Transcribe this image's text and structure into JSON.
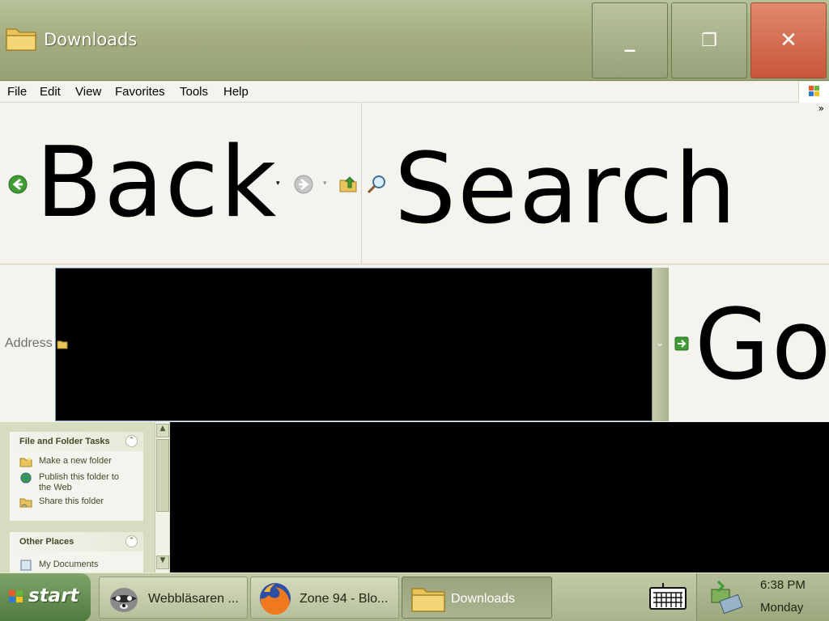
{
  "window": {
    "title": "Downloads",
    "min_glyph": "_",
    "max_glyph": "❐",
    "close_glyph": "✕"
  },
  "menu": {
    "file": "File",
    "edit": "Edit",
    "view": "View",
    "favorites": "Favorites",
    "tools": "Tools",
    "help": "Help"
  },
  "toolbar": {
    "back_label": "Back",
    "search_label": "Search",
    "more_glyph": "»"
  },
  "address": {
    "label": "Address",
    "go_label": "Go"
  },
  "left_panel": {
    "file_tasks": {
      "title": "File and Folder Tasks",
      "items": [
        "Make a new folder",
        "Publish this folder to the Web",
        "Share this folder"
      ]
    },
    "other_places": {
      "title": "Other Places",
      "items": [
        "My Documents"
      ]
    }
  },
  "taskbar": {
    "start_label": "start",
    "items": [
      {
        "label": "Webbläsaren ...",
        "icon": "raccoon-icon"
      },
      {
        "label": "Zone 94 - Blo...",
        "icon": "firefox-icon"
      },
      {
        "label": "Downloads",
        "icon": "folder-icon"
      }
    ],
    "clock": "6:38 PM",
    "day": "Monday"
  },
  "colors": {
    "title_bar": "#a4ae82",
    "close_button": "#c9563a",
    "task_pane": "#d6dcbf",
    "content_area": "#000000"
  }
}
